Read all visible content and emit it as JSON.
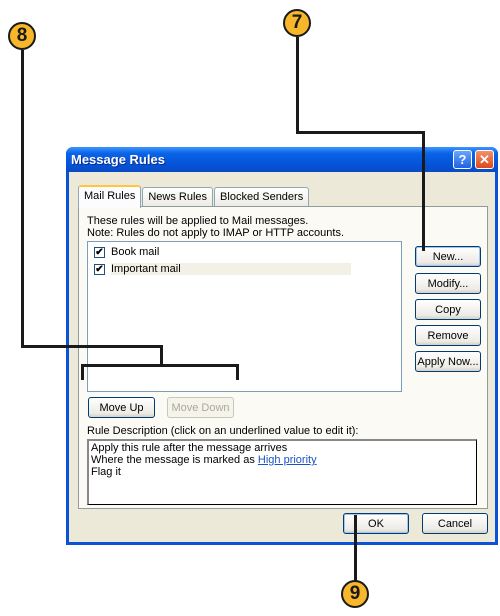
{
  "callouts": [
    {
      "number": "8",
      "target": "Move Up / Move Down buttons"
    },
    {
      "number": "7",
      "target": "New... button"
    },
    {
      "number": "9",
      "target": "OK button"
    }
  ],
  "window": {
    "title": "Message Rules",
    "help_icon": "help-icon",
    "close_icon": "close-icon",
    "help_glyph": "?",
    "close_glyph": "✕"
  },
  "tabs": [
    {
      "label": "Mail Rules",
      "active": true
    },
    {
      "label": "News Rules",
      "active": false
    },
    {
      "label": "Blocked Senders",
      "active": false
    }
  ],
  "notes": {
    "line1": "These rules will be applied to Mail messages.",
    "line2": "Note: Rules do not apply to IMAP or HTTP accounts."
  },
  "rules": [
    {
      "name": "Book mail",
      "checked": true,
      "check_glyph": "✔"
    },
    {
      "name": "Important mail",
      "checked": true,
      "check_glyph": "✔",
      "selected": true
    }
  ],
  "side_buttons": {
    "new": "New...",
    "modify": "Modify...",
    "copy": "Copy",
    "remove": "Remove",
    "apply_now": "Apply Now..."
  },
  "move_buttons": {
    "move_up": "Move Up",
    "move_down": "Move Down"
  },
  "description": {
    "label": "Rule Description (click on an underlined value to edit it):",
    "line1": "Apply this rule after the message arrives",
    "line2_prefix": "Where the message is marked as ",
    "line2_link": "High priority",
    "line3": "Flag it"
  },
  "footer": {
    "ok": "OK",
    "cancel": "Cancel"
  },
  "colors": {
    "callout_fill": "#f8b62a",
    "titlebar_blue": "#0553d8",
    "link_blue": "#1a52c4"
  }
}
